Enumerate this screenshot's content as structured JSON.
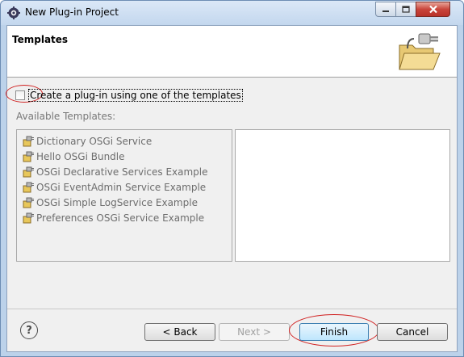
{
  "window": {
    "title": "New Plug-in Project",
    "icons": {
      "app": "eclipse-gear-icon",
      "minimize": "minimize-icon",
      "maximize": "maximize-icon",
      "close": "close-icon"
    }
  },
  "header": {
    "title": "Templates",
    "art_icon": "plug-in-folder-icon"
  },
  "checkbox": {
    "label": "Create a plug-in using one of the templates",
    "checked": false
  },
  "templates": {
    "label": "Available Templates:",
    "items": [
      "Dictionary OSGi Service",
      "Hello OSGi Bundle",
      "OSGi Declarative Services Example",
      "OSGi EventAdmin Service Example",
      "OSGi Simple LogService Example",
      "Preferences OSGi Service Example"
    ],
    "item_icon": "plug-in-icon"
  },
  "buttons": {
    "back": "< Back",
    "next": "Next >",
    "finish": "Finish",
    "cancel": "Cancel"
  },
  "colors": {
    "annotation_red": "#d02020",
    "disabled_text": "#6d6d6d"
  }
}
